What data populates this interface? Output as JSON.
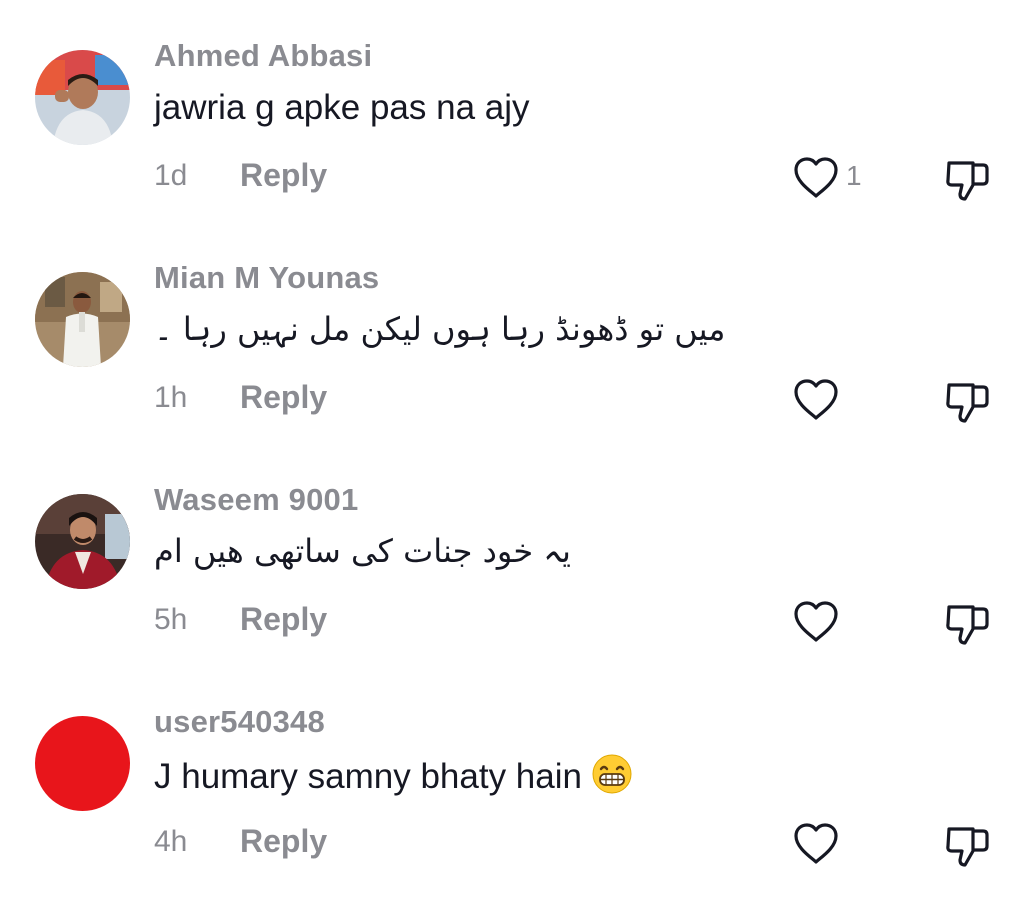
{
  "comments": [
    {
      "username": "Ahmed Abbasi",
      "text": "jawria g apke pas na ajy",
      "text_dir": "ltr",
      "time": "1d",
      "reply_label": "Reply",
      "like_count": "1",
      "avatar": "photo-avatar-man-red-background",
      "emoji": ""
    },
    {
      "username": "Mian M Younas",
      "text": "میں تو ڈھونڈ رہا ہوں لیکن مل نہیں رہا ۔",
      "text_dir": "rtl",
      "time": "1h",
      "reply_label": "Reply",
      "like_count": "",
      "avatar": "photo-avatar-man-white-outfit",
      "emoji": ""
    },
    {
      "username": "Waseem 9001",
      "text": "یہ خود جنات کی ساتھی ھیں ام",
      "text_dir": "rtl",
      "time": "5h",
      "reply_label": "Reply",
      "like_count": "",
      "avatar": "photo-avatar-man-red-jacket",
      "emoji": ""
    },
    {
      "username": "user540348",
      "text": "J humary samny bhaty hain",
      "text_dir": "ltr",
      "time": "4h",
      "reply_label": "Reply",
      "like_count": "",
      "avatar": "red-circle-avatar",
      "emoji": "grinning-face-emoji"
    }
  ],
  "icons": {
    "like": "heart-outline-icon",
    "dislike": "thumbs-down-outline-icon"
  },
  "colors": {
    "username": "#8a8b91",
    "text": "#161823",
    "meta": "#8a8b91",
    "icon": "#161823",
    "red_avatar": "#e8151b"
  }
}
